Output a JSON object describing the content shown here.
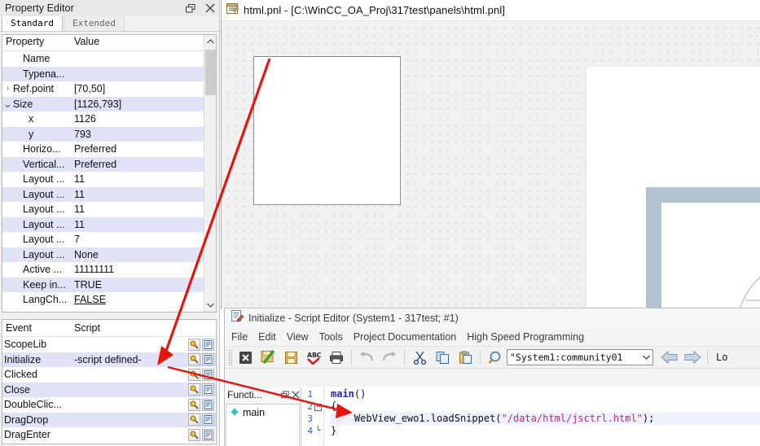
{
  "property_editor": {
    "title": "Property Editor",
    "window_buttons": [
      {
        "name": "restore-icon",
        "glyph": "restore"
      },
      {
        "name": "close-icon",
        "glyph": "close"
      }
    ],
    "tabs": [
      {
        "label": "Standard",
        "active": true
      },
      {
        "label": "Extended",
        "active": false
      }
    ],
    "columns": [
      "Property",
      "Value"
    ],
    "rows": [
      {
        "twisty": "",
        "indent": 1,
        "name": "Name",
        "value": "",
        "alt": false
      },
      {
        "twisty": "",
        "indent": 1,
        "name": "Typena...",
        "value": "",
        "alt": true
      },
      {
        "twisty": ">",
        "indent": 0,
        "name": "Ref.point",
        "value": "[70,50]",
        "alt": false
      },
      {
        "twisty": "v",
        "indent": 0,
        "name": "Size",
        "value": "[1126,793]",
        "alt": true
      },
      {
        "twisty": "",
        "indent": 2,
        "name": "x",
        "value": "1126",
        "alt": false
      },
      {
        "twisty": "",
        "indent": 2,
        "name": "y",
        "value": "793",
        "alt": true
      },
      {
        "twisty": "",
        "indent": 1,
        "name": "Horizo...",
        "value": "Preferred",
        "alt": false
      },
      {
        "twisty": "",
        "indent": 1,
        "name": "Vertical...",
        "value": "Preferred",
        "alt": true
      },
      {
        "twisty": "",
        "indent": 1,
        "name": "Layout ...",
        "value": "11",
        "alt": false
      },
      {
        "twisty": "",
        "indent": 1,
        "name": "Layout ...",
        "value": "11",
        "alt": true
      },
      {
        "twisty": "",
        "indent": 1,
        "name": "Layout ...",
        "value": "11",
        "alt": false
      },
      {
        "twisty": "",
        "indent": 1,
        "name": "Layout ...",
        "value": "11",
        "alt": true
      },
      {
        "twisty": "",
        "indent": 1,
        "name": "Layout ...",
        "value": "7",
        "alt": false
      },
      {
        "twisty": "",
        "indent": 1,
        "name": "Layout ...",
        "value": "None",
        "alt": true
      },
      {
        "twisty": "",
        "indent": 1,
        "name": "Active ...",
        "value": "11111111",
        "alt": false,
        "button": "..."
      },
      {
        "twisty": "",
        "indent": 1,
        "name": "Keep in...",
        "value": "TRUE",
        "alt": true
      },
      {
        "twisty": "",
        "indent": 1,
        "name": "LangCh...",
        "value": "FALSE",
        "alt": false,
        "underline": true
      }
    ],
    "scrollbar": {
      "up": "▲",
      "down": "▼"
    }
  },
  "event_panel": {
    "columns": [
      "Event",
      "Script"
    ],
    "rows": [
      {
        "event": "ScopeLib",
        "script": "",
        "alt": false
      },
      {
        "event": "Initialize",
        "script": "-script defined-",
        "alt": true
      },
      {
        "event": "Clicked",
        "script": "",
        "alt": false
      },
      {
        "event": "Close",
        "script": "",
        "alt": true
      },
      {
        "event": "DoubleClic...",
        "script": "",
        "alt": false
      },
      {
        "event": "DragDrop",
        "script": "",
        "alt": true
      },
      {
        "event": "DragEnter",
        "script": "",
        "alt": false
      }
    ],
    "row_buttons": [
      {
        "name": "magnifier-icon"
      },
      {
        "name": "script-document-icon"
      }
    ]
  },
  "panel_editor": {
    "title": "html.pnl - [C:\\WinCC_OA_Proj\\317test\\panels\\html.pnl]",
    "icon": "panel-file-icon",
    "canvas": {
      "widget_name": "webview-widget-placeholder",
      "background_logo": "globe-watermark"
    }
  },
  "script_editor": {
    "title": "Initialize - Script Editor (System1 - 317test; #1)",
    "icon": "script-editor-icon",
    "menus": [
      "File",
      "Edit",
      "View",
      "Tools",
      "Project Documentation",
      "High Speed Programming"
    ],
    "toolbar": [
      {
        "name": "cancel-button",
        "glyph": "x"
      },
      {
        "name": "accept-check-button",
        "glyph": "check"
      },
      {
        "name": "save-button",
        "glyph": "floppy"
      },
      {
        "name": "spellcheck-button",
        "glyph": "abc"
      },
      {
        "name": "print-button",
        "glyph": "printer"
      },
      {
        "name": "undo-button",
        "glyph": "undo"
      },
      {
        "name": "redo-button",
        "glyph": "redo"
      },
      {
        "name": "cut-button",
        "glyph": "scissors"
      },
      {
        "name": "copy-button",
        "glyph": "copy"
      },
      {
        "name": "paste-button",
        "glyph": "paste"
      },
      {
        "name": "find-button",
        "glyph": "find"
      }
    ],
    "scope_combo": {
      "value": "\"System1:community01",
      "arrow": "⌄"
    },
    "nav_back": "back-arrow-button",
    "nav_forward": "forward-arrow-button",
    "trailing_label": "Lo",
    "functions_panel": {
      "title": "Functi...",
      "buttons": [
        {
          "name": "undock-icon"
        },
        {
          "name": "close-icon"
        }
      ],
      "items": [
        {
          "label": "main",
          "icon": "function-diamond-icon"
        }
      ]
    },
    "code": {
      "lines": [
        {
          "num": "1",
          "fold": "",
          "highlight": false,
          "tokens": [
            {
              "t": "main",
              "c": "kw"
            },
            {
              "t": "()",
              "c": ""
            }
          ]
        },
        {
          "num": "2",
          "fold": "-",
          "highlight": false,
          "tokens": [
            {
              "t": "{",
              "c": ""
            }
          ]
        },
        {
          "num": "3",
          "fold": "",
          "highlight": true,
          "tokens": [
            {
              "t": "    WebView_ewo1.loadSnippet(",
              "c": ""
            },
            {
              "t": "\"/data/html/jsctrl.html\"",
              "c": "str"
            },
            {
              "t": ");",
              "c": ""
            }
          ]
        },
        {
          "num": "4",
          "fold": "L",
          "highlight": false,
          "tokens": [
            {
              "t": "}",
              "c": ""
            }
          ]
        }
      ]
    }
  },
  "annotations": {
    "arrow_color": "#e8140c",
    "arrows": [
      {
        "name": "arrow-canvas-to-initialize-event"
      },
      {
        "name": "arrow-initialize-event-to-code-line"
      }
    ]
  }
}
